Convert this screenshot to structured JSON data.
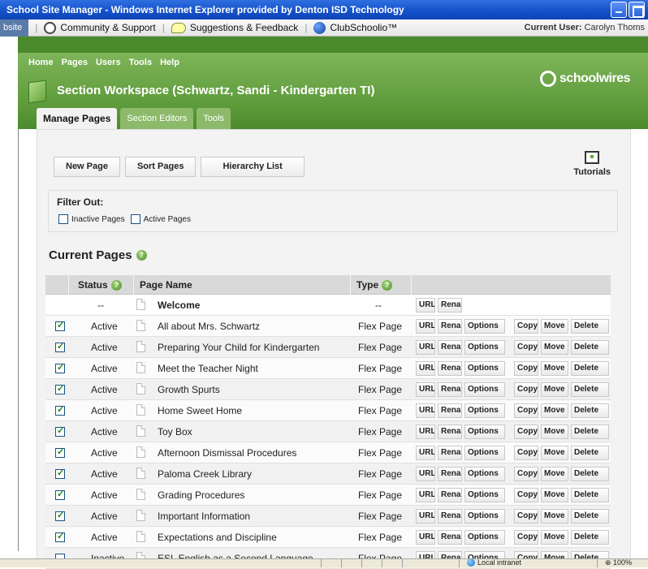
{
  "browser": {
    "title": "School Site Manager - Windows Internet Explorer provided by Denton ISD Technology",
    "links_site": "bsite",
    "links": [
      "Community & Support",
      "Suggestions & Feedback",
      "ClubSchoolio™"
    ],
    "current_user_label": "Current User:",
    "current_user_name": "Carolyn Thoms"
  },
  "menu": [
    "Home",
    "Pages",
    "Users",
    "Tools",
    "Help"
  ],
  "logo_text": "schoolwires",
  "workspace_title": "Section Workspace (Schwartz, Sandi - Kindergarten TI)",
  "tabs": [
    "Manage Pages",
    "Section Editors",
    "Tools"
  ],
  "toolbar": {
    "new_page": "New Page",
    "sort_pages": "Sort Pages",
    "hierarchy_list": "Hierarchy List",
    "tutorials": "Tutorials"
  },
  "filter": {
    "title": "Filter Out:",
    "inactive": "Inactive Pages",
    "active": "Active Pages"
  },
  "current_pages_title": "Current Pages",
  "table": {
    "headers": {
      "status": "Status",
      "page_name": "Page Name",
      "type": "Type"
    },
    "actions": {
      "url": "URL",
      "rename": "Rename",
      "options": "Options",
      "copy": "Copy",
      "move": "Move",
      "delete": "Delete"
    },
    "rows": [
      {
        "checked": null,
        "status": "--",
        "name": "Welcome",
        "type": "--",
        "welcome": true
      },
      {
        "checked": true,
        "status": "Active",
        "name": "All about Mrs. Schwartz",
        "type": "Flex Page"
      },
      {
        "checked": true,
        "status": "Active",
        "name": "Preparing Your Child for Kindergarten",
        "type": "Flex Page"
      },
      {
        "checked": true,
        "status": "Active",
        "name": "Meet the Teacher Night",
        "type": "Flex Page"
      },
      {
        "checked": true,
        "status": "Active",
        "name": "Growth Spurts",
        "type": "Flex Page"
      },
      {
        "checked": true,
        "status": "Active",
        "name": "Home Sweet Home",
        "type": "Flex Page"
      },
      {
        "checked": true,
        "status": "Active",
        "name": "Toy Box",
        "type": "Flex Page"
      },
      {
        "checked": true,
        "status": "Active",
        "name": "Afternoon Dismissal Procedures",
        "type": "Flex Page"
      },
      {
        "checked": true,
        "status": "Active",
        "name": "Paloma Creek Library",
        "type": "Flex Page"
      },
      {
        "checked": true,
        "status": "Active",
        "name": "Grading Procedures",
        "type": "Flex Page"
      },
      {
        "checked": true,
        "status": "Active",
        "name": "Important Information",
        "type": "Flex Page"
      },
      {
        "checked": true,
        "status": "Active",
        "name": "Expectations and Discipline",
        "type": "Flex Page"
      },
      {
        "checked": false,
        "status": "Inactive",
        "name": "ESL English as a Second Language",
        "type": "Flex Page"
      }
    ]
  },
  "statusbar": {
    "zone": "Local intranet",
    "zoom": "100%"
  }
}
